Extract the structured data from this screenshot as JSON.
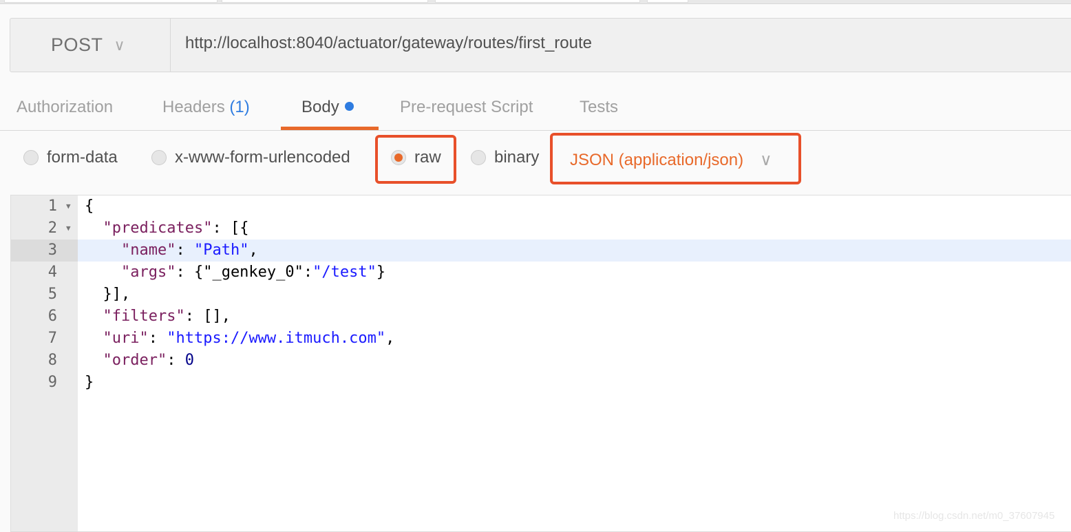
{
  "request": {
    "method": "POST",
    "url": "http://localhost:8040/actuator/gateway/routes/first_route"
  },
  "tabs": [
    {
      "label": "Authorization"
    },
    {
      "label": "Headers",
      "count": "(1)"
    },
    {
      "label": "Body",
      "active": true
    },
    {
      "label": "Pre-request Script"
    },
    {
      "label": "Tests"
    }
  ],
  "body_modes": [
    {
      "label": "form-data"
    },
    {
      "label": "x-www-form-urlencoded"
    },
    {
      "label": "raw",
      "selected": true
    },
    {
      "label": "binary"
    }
  ],
  "content_type": "JSON (application/json)",
  "colors": {
    "accent": "#e8692a",
    "highlight_box": "#e8502a",
    "tab_dot": "#2e7ce0"
  },
  "code_lines": [
    [
      [
        "p",
        "{"
      ]
    ],
    [
      [
        "p",
        "  "
      ],
      [
        "k",
        "\"predicates\""
      ],
      [
        "p",
        ": [{"
      ]
    ],
    [
      [
        "p",
        "    "
      ],
      [
        "k",
        "\"name\""
      ],
      [
        "p",
        ": "
      ],
      [
        "s",
        "\"Path\""
      ],
      [
        "p",
        ","
      ]
    ],
    [
      [
        "p",
        "    "
      ],
      [
        "k",
        "\"args\""
      ],
      [
        "p",
        ": {\"_genkey_0\":"
      ],
      [
        "s",
        "\"/test\""
      ],
      [
        "p",
        "}"
      ]
    ],
    [
      [
        "p",
        "  }],"
      ]
    ],
    [
      [
        "p",
        "  "
      ],
      [
        "k",
        "\"filters\""
      ],
      [
        "p",
        ": [],"
      ]
    ],
    [
      [
        "p",
        "  "
      ],
      [
        "k",
        "\"uri\""
      ],
      [
        "p",
        ": "
      ],
      [
        "s",
        "\"https://www.itmuch.com\""
      ],
      [
        "p",
        ","
      ]
    ],
    [
      [
        "p",
        "  "
      ],
      [
        "k",
        "\"order\""
      ],
      [
        "p",
        ": "
      ],
      [
        "n",
        "0"
      ]
    ],
    [
      [
        "p",
        "}"
      ]
    ]
  ],
  "watermark": "https://blog.csdn.net/m0_37607945"
}
